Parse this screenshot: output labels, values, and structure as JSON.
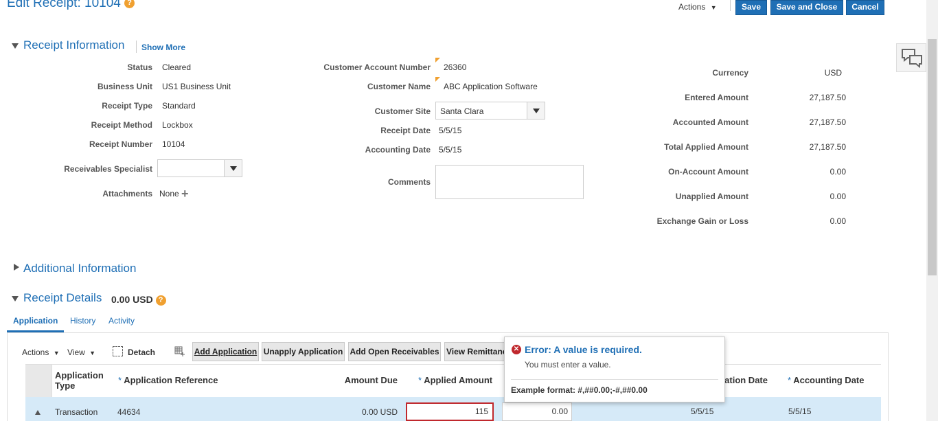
{
  "header": {
    "title": "Edit Receipt: 10104",
    "actions_label": "Actions",
    "save_label": "Save",
    "save_close_label": "Save and Close",
    "cancel_label": "Cancel"
  },
  "receipt_info": {
    "section_title": "Receipt Information",
    "show_more_label": "Show More",
    "left": [
      {
        "label": "Status",
        "value": "Cleared"
      },
      {
        "label": "Business Unit",
        "value": "US1 Business Unit"
      },
      {
        "label": "Receipt Type",
        "value": "Standard"
      },
      {
        "label": "Receipt Method",
        "value": "Lockbox"
      },
      {
        "label": "Receipt Number",
        "value": "10104"
      }
    ],
    "receivables_specialist_label": "Receivables Specialist",
    "receivables_specialist_value": "",
    "attachments_label": "Attachments",
    "attachments_value": "None",
    "middle": {
      "customer_account_number_label": "Customer Account Number",
      "customer_account_number_value": "26360",
      "customer_name_label": "Customer Name",
      "customer_name_value": "ABC Application Software",
      "customer_site_label": "Customer Site",
      "customer_site_value": "Santa Clara",
      "receipt_date_label": "Receipt Date",
      "receipt_date_value": "5/5/15",
      "accounting_date_label": "Accounting Date",
      "accounting_date_value": "5/5/15",
      "comments_label": "Comments",
      "comments_value": ""
    },
    "right": [
      {
        "label": "Currency",
        "value": "USD"
      },
      {
        "label": "Entered Amount",
        "value": "27,187.50"
      },
      {
        "label": "Accounted Amount",
        "value": "27,187.50"
      },
      {
        "label": "Total Applied Amount",
        "value": "27,187.50"
      },
      {
        "label": "On-Account Amount",
        "value": "0.00"
      },
      {
        "label": "Unapplied Amount",
        "value": "0.00"
      },
      {
        "label": "Exchange Gain or Loss",
        "value": "0.00"
      }
    ]
  },
  "additional_info": {
    "section_title": "Additional Information"
  },
  "receipt_details": {
    "section_title": "Receipt Details",
    "amount": "0.00 USD",
    "tabs": [
      {
        "label": "Application"
      },
      {
        "label": "History"
      },
      {
        "label": "Activity"
      }
    ],
    "toolbar": {
      "actions_label": "Actions",
      "view_label": "View",
      "detach_label": "Detach",
      "add_application_label": "Add Application",
      "unapply_application_label": "Unapply Application",
      "add_open_receivables_label": "Add Open Receivables",
      "view_remittance_label": "View Remittance"
    },
    "columns": {
      "application_type": "Application Type",
      "application_reference": "Application Reference",
      "amount_due": "Amount Due",
      "applied_amount": "Applied Amount",
      "application_date": "Application Date",
      "accounting_date": "Accounting Date"
    },
    "row": {
      "application_type": "Transaction",
      "application_reference": "44634",
      "amount_due": "0.00 USD",
      "applied_amount": "115",
      "other_amount": "0.00",
      "application_date": "5/5/15",
      "accounting_date": "5/5/15"
    }
  },
  "error_popup": {
    "title": "Error: A value is required.",
    "message": "You must enter a value.",
    "example": "Example format: #,##0.00;-#,##0.00"
  },
  "colors": {
    "brand": "#1f6fb5",
    "error": "#c0282d",
    "help": "#f0a030"
  }
}
